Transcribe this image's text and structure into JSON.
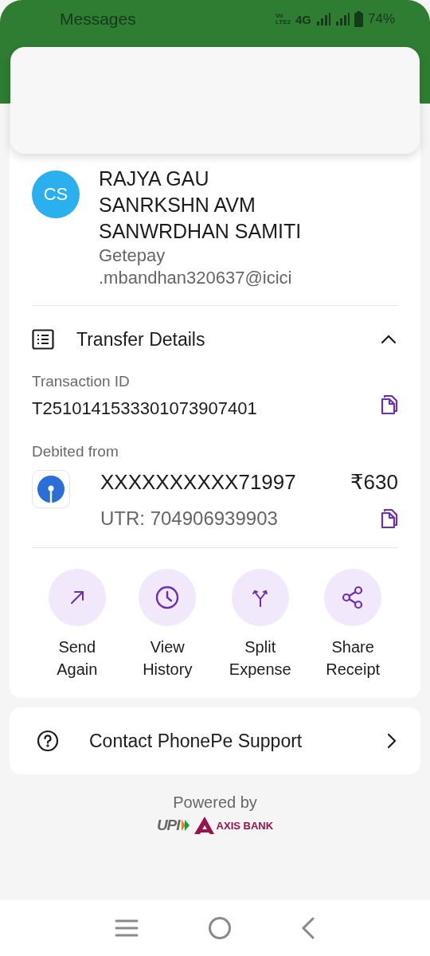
{
  "status_bar": {
    "app": "Messages",
    "volte_top": "Vo",
    "volte_bottom": "LTE2",
    "network": "4G",
    "battery": "74%"
  },
  "payee": {
    "initials": "CS",
    "name_lines": [
      "RAJYA GAU",
      "SANRKSHN AVM",
      "SANWRDHAN SAMITI"
    ],
    "vpa_lines": [
      "Getepay",
      ".mbandhan320637@icici"
    ]
  },
  "transfer_details": {
    "title": "Transfer Details",
    "expanded": true,
    "transaction_id_label": "Transaction ID",
    "transaction_id": "T2510141533301073907401",
    "debited_label": "Debited from",
    "account": "XXXXXXXXXX71997",
    "amount": "₹630",
    "utr": "UTR: 704906939903"
  },
  "actions": [
    {
      "kind": "send",
      "label": "Send Again"
    },
    {
      "kind": "history",
      "label": "View History"
    },
    {
      "kind": "split",
      "label": "Split Expense"
    },
    {
      "kind": "share",
      "label": "Share Receipt"
    }
  ],
  "support": {
    "label": "Contact PhonePe Support"
  },
  "footer": {
    "powered_by": "Powered by",
    "upi": "UPI",
    "bank": "AXIS BANK"
  }
}
